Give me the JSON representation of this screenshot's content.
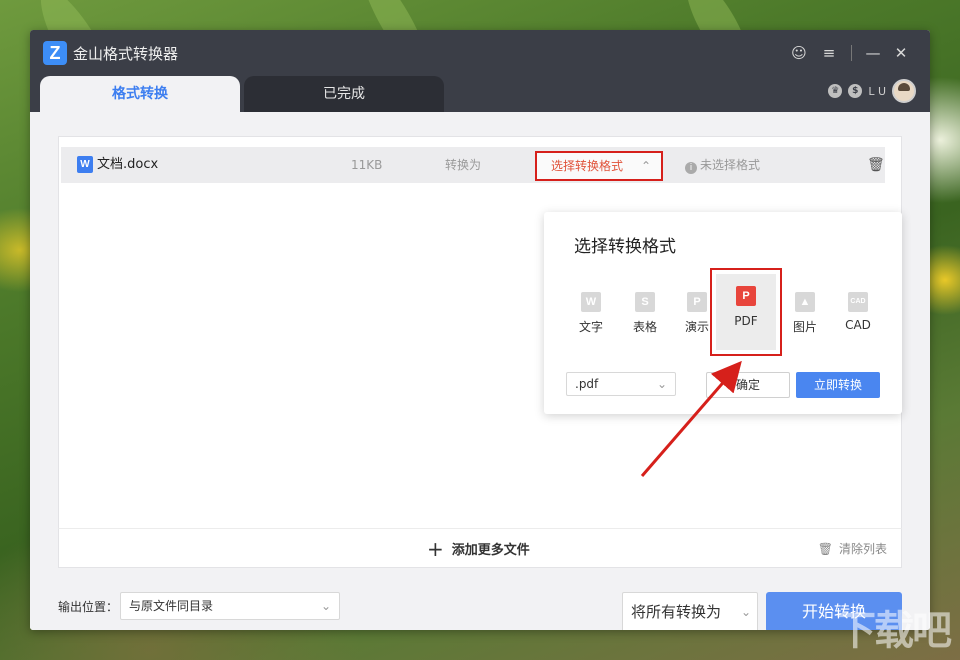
{
  "app": {
    "title": "金山格式转换器",
    "logo_letter": "Z"
  },
  "tabs": [
    {
      "label": "格式转换",
      "active": true
    },
    {
      "label": "已完成",
      "active": false
    }
  ],
  "user": {
    "initials": "L U"
  },
  "file_row": {
    "file_icon": "W",
    "file_name": "文档.docx",
    "file_size": "11KB",
    "convert_label": "转换为",
    "format_select": "选择转换格式",
    "status": "未选择格式"
  },
  "popup": {
    "title": "选择转换格式",
    "formats": [
      {
        "icon": "W",
        "label": "文字"
      },
      {
        "icon": "S",
        "label": "表格"
      },
      {
        "icon": "P",
        "label": "演示"
      },
      {
        "icon": "P",
        "label": "PDF",
        "selected": true
      },
      {
        "icon": "▲",
        "label": "图片"
      },
      {
        "icon": "CAD",
        "label": "CAD"
      }
    ],
    "extension": ".pdf",
    "confirm_label": "确定",
    "convert_now_label": "立即转换"
  },
  "footer": {
    "add_more": "添加更多文件",
    "clear_list": "清除列表"
  },
  "bottom": {
    "output_label": "输出位置：",
    "output_value": "与原文件同目录",
    "convert_all": "将所有转换为",
    "start_button": "开始转换"
  },
  "watermark": "下载吧",
  "colors": {
    "accent": "#3d7ef0",
    "highlight_red": "#d6201b",
    "pdf_red": "#e8453c"
  }
}
